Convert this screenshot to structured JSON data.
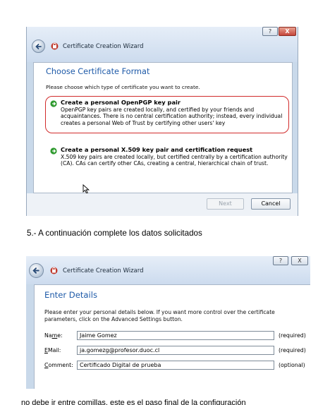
{
  "wizard1": {
    "window_title": "Certificate Creation Wizard",
    "help_button": "?",
    "close_button": "X",
    "heading": "Choose Certificate Format",
    "instruction": "Please choose which type of certificate you want to create.",
    "options": [
      {
        "title": "Create a personal OpenPGP key pair",
        "description": "OpenPGP key pairs are created locally, and certified by your friends and acquaintances. There is no central certification authority; instead, every individual creates a personal Web of Trust by certifying other users' key",
        "highlighted": true
      },
      {
        "title": "Create a personal X.509 key pair and certification request",
        "description": "X.509 key pairs are created locally, but certified centrally by a certification authority (CA). CAs can certify other CAs, creating a central, hierarchical chain of trust.",
        "highlighted": false
      }
    ],
    "next_button": "Next",
    "cancel_button": "Cancel"
  },
  "caption": "5.- A continuación complete los datos solicitados",
  "wizard2": {
    "window_title": "Certificate Creation Wizard",
    "heading": "Enter Details",
    "instruction": "Please enter your personal details below. If you want more control over the certificate parameters, click on the Advanced Settings button.",
    "fields": [
      {
        "label_first": "Na",
        "label_accel": "m",
        "label_rest": "e:",
        "value": "Jaime Gomez",
        "note": "(required)"
      },
      {
        "label_first": "",
        "label_accel": "E",
        "label_rest": "Mail:",
        "value": "ja.gomezg@profesor.duoc.cl",
        "note": "(required)"
      },
      {
        "label_first": "",
        "label_accel": "C",
        "label_rest": "omment:",
        "value": "Certificado Digital de prueba",
        "note": "(optional)"
      }
    ]
  },
  "cut_text": "no debe ir entre comillas, este es el paso final de la configuración",
  "colors": {
    "heading": "#1e5aa8",
    "highlight_ring": "#d12b2b",
    "option_arrow": "#2f9a2f"
  }
}
